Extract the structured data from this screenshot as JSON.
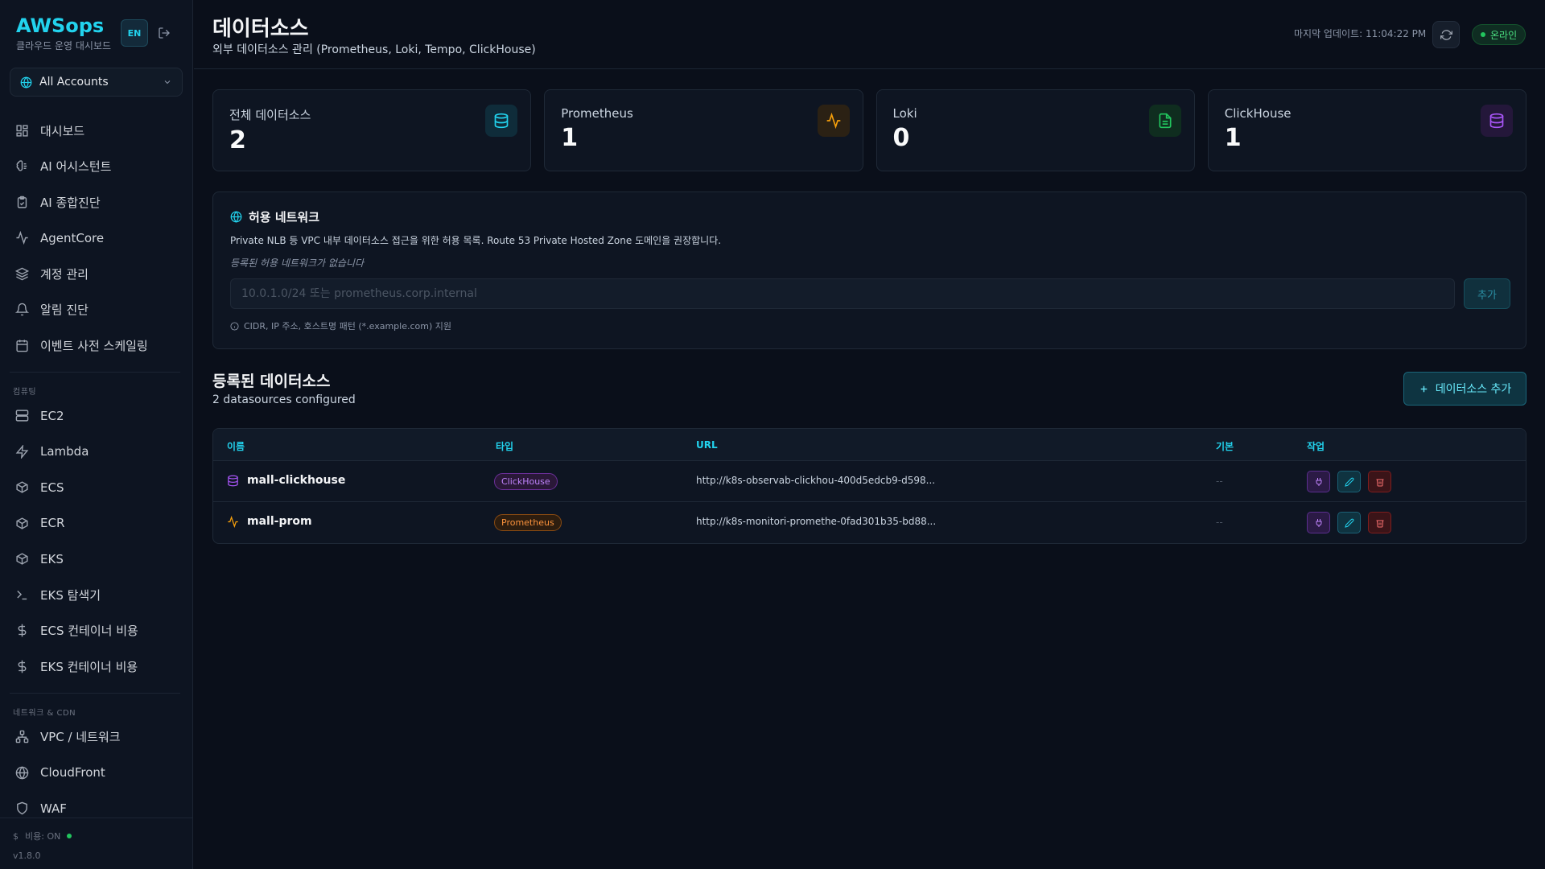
{
  "sidebar": {
    "brand": "AWSops",
    "brand_sub": "클라우드 운영 대시보드",
    "lang": "EN",
    "account": "All Accounts",
    "items": [
      {
        "label": "대시보드",
        "icon": "grid-icon"
      },
      {
        "label": "AI 어시스턴트",
        "icon": "brain-icon"
      },
      {
        "label": "AI 종합진단",
        "icon": "clipboard-check-icon"
      },
      {
        "label": "AgentCore",
        "icon": "activity-icon"
      },
      {
        "label": "계정 관리",
        "icon": "layers-icon"
      },
      {
        "label": "알림 진단",
        "icon": "bell-icon"
      },
      {
        "label": "이벤트 사전 스케일링",
        "icon": "calendar-icon"
      }
    ],
    "section_compute": "컴퓨팅",
    "compute_items": [
      {
        "label": "EC2",
        "icon": "server-icon"
      },
      {
        "label": "Lambda",
        "icon": "zap-icon"
      },
      {
        "label": "ECS",
        "icon": "box-icon"
      },
      {
        "label": "ECR",
        "icon": "box-icon"
      },
      {
        "label": "EKS",
        "icon": "box-icon"
      },
      {
        "label": "EKS 탐색기",
        "icon": "terminal-icon"
      },
      {
        "label": "ECS 컨테이너 비용",
        "icon": "dollar-icon"
      },
      {
        "label": "EKS 컨테이너 비용",
        "icon": "dollar-icon"
      }
    ],
    "section_network": "네트워크 & CDN",
    "network_items": [
      {
        "label": "VPC / 네트워크",
        "icon": "network-icon"
      },
      {
        "label": "CloudFront",
        "icon": "globe-icon"
      },
      {
        "label": "WAF",
        "icon": "shield-icon"
      }
    ],
    "footer": {
      "cost": "비용: ON",
      "version": "v1.8.0"
    }
  },
  "header": {
    "title": "데이터소스",
    "subtitle": "외부 데이터소스 관리 (Prometheus, Loki, Tempo, ClickHouse)",
    "last_update": "마지막 업데이트: 11:04:22 PM",
    "status": "온라인"
  },
  "stats": [
    {
      "label": "전체 데이터소스",
      "value": "2",
      "icon": "database-icon",
      "color": "#22d3ee",
      "bg": "#0f2c3a"
    },
    {
      "label": "Prometheus",
      "value": "1",
      "icon": "activity-icon",
      "color": "#f59e0b",
      "bg": "#2b2114"
    },
    {
      "label": "Loki",
      "value": "0",
      "icon": "file-text-icon",
      "color": "#22c55e",
      "bg": "#0f2d1f"
    },
    {
      "label": "ClickHouse",
      "value": "1",
      "icon": "database-icon",
      "color": "#a855f7",
      "bg": "#24173a"
    }
  ],
  "allowed_network": {
    "title": "허용 네트워크",
    "description": "Private NLB 등 VPC 내부 데이터소스 접근을 위한 허용 목록. Route 53 Private Hosted Zone 도메인을 권장합니다.",
    "empty": "등록된 허용 네트워크가 없습니다",
    "input_value": "",
    "placeholder": "10.0.1.0/24 또는 prometheus.corp.internal",
    "add": "추가",
    "hint": "CIDR, IP 주소, 호스트명 패턴 (*.example.com) 지원"
  },
  "registered": {
    "title": "등록된 데이터소스",
    "subtitle": "2 datasources configured",
    "add_button": "데이터소스 추가",
    "columns": {
      "name": "이름",
      "type": "타입",
      "url": "URL",
      "default": "기본",
      "actions": "작업"
    },
    "rows": [
      {
        "name": "mall-clickhouse",
        "type": "ClickHouse",
        "url": "http://k8s-observab-clickhou-400d5edcb9-d598...",
        "default": "--"
      },
      {
        "name": "mall-prom",
        "type": "Prometheus",
        "url": "http://k8s-monitori-promethe-0fad301b35-bd88...",
        "default": "--"
      }
    ]
  }
}
